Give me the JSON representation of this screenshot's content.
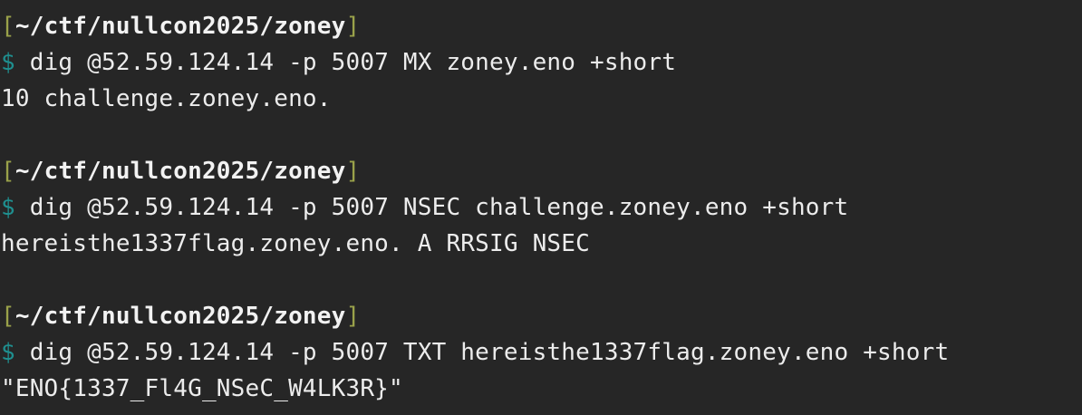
{
  "colors": {
    "background": "#262626",
    "text": "#ececec",
    "bracket": "#9aa24a",
    "prompt_symbol": "#1f8f8f"
  },
  "terminal": {
    "blocks": [
      {
        "cwd": "~/ctf/nullcon2025/zoney",
        "bracket_open": "[",
        "bracket_close": "]",
        "prompt": "$",
        "command": " dig @52.59.124.14 -p 5007 MX zoney.eno +short",
        "output": "10 challenge.zoney.eno."
      },
      {
        "cwd": "~/ctf/nullcon2025/zoney",
        "bracket_open": "[",
        "bracket_close": "]",
        "prompt": "$",
        "command": " dig @52.59.124.14 -p 5007 NSEC challenge.zoney.eno +short",
        "output": "hereisthe1337flag.zoney.eno. A RRSIG NSEC"
      },
      {
        "cwd": "~/ctf/nullcon2025/zoney",
        "bracket_open": "[",
        "bracket_close": "]",
        "prompt": "$",
        "command": " dig @52.59.124.14 -p 5007 TXT hereisthe1337flag.zoney.eno +short",
        "output": "\"ENO{1337_Fl4G_NSeC_W4LK3R}\""
      }
    ]
  }
}
